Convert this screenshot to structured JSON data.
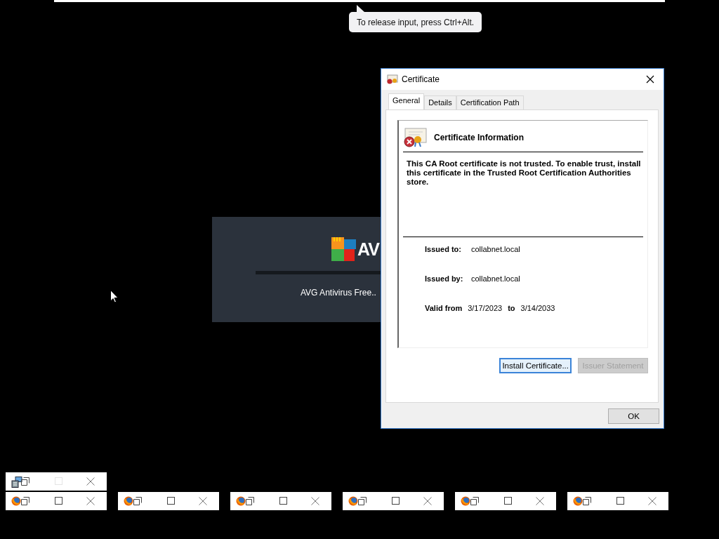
{
  "tooltip": {
    "text": "To release input, press Ctrl+Alt."
  },
  "splash": {
    "logo_text": "AV",
    "caption": "AVG Antivirus Free.."
  },
  "dialog": {
    "title": "Certificate",
    "tabs": [
      {
        "label": "General",
        "selected": true
      },
      {
        "label": "Details",
        "selected": false
      },
      {
        "label": "Certification Path",
        "selected": false
      }
    ],
    "heading": "Certificate Information",
    "message": "This CA Root certificate is not trusted. To enable trust, install this certificate in the Trusted Root Certification Authorities store.",
    "fields": [
      {
        "label": "Issued to:",
        "value": "collabnet.local"
      },
      {
        "label": "Issued by:",
        "value": "collabnet.local"
      }
    ],
    "validity": {
      "label": "Valid from",
      "from": "3/17/2023",
      "to_label": "to",
      "to": "3/14/2033"
    },
    "buttons": [
      {
        "label": "Install Certificate...",
        "focused": true,
        "disabled": false
      },
      {
        "label": "Issuer Statement",
        "focused": false,
        "disabled": true
      }
    ],
    "ok": "OK"
  },
  "minimized_windows": {
    "upper_row": [
      {
        "kind": "installer",
        "maximize_enabled": false
      }
    ],
    "lower_row": [
      {
        "kind": "firefox",
        "maximize_enabled": true
      },
      {
        "kind": "firefox",
        "maximize_enabled": true
      },
      {
        "kind": "firefox",
        "maximize_enabled": true
      },
      {
        "kind": "firefox",
        "maximize_enabled": true
      },
      {
        "kind": "firefox",
        "maximize_enabled": true
      },
      {
        "kind": "firefox",
        "maximize_enabled": true
      }
    ]
  }
}
